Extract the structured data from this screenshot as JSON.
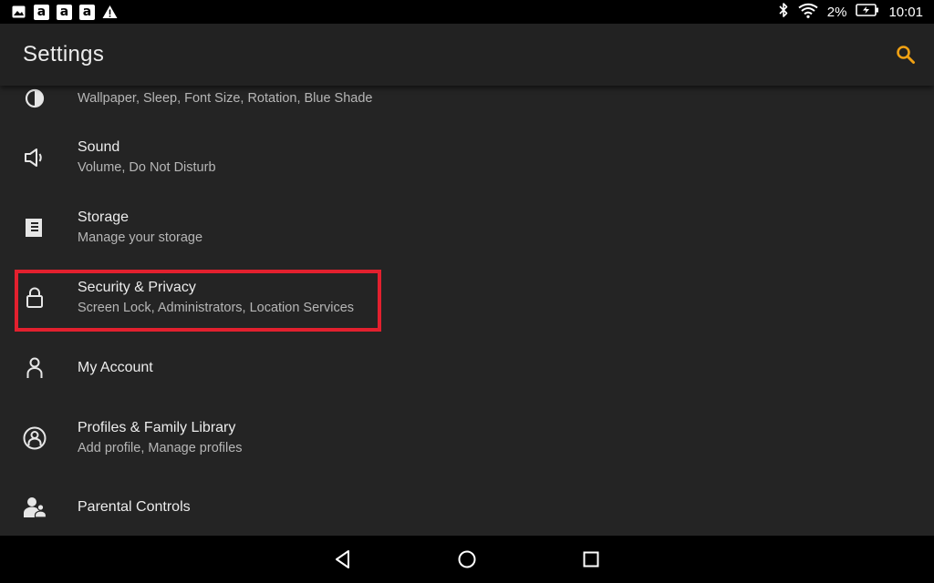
{
  "status_bar": {
    "notification_icons": [
      "image-icon",
      "amazon-icon",
      "amazon-icon",
      "amazon-icon",
      "warning-icon"
    ],
    "amazon_glyph": "a",
    "battery_percent": "2%",
    "time": "10:01"
  },
  "app_bar": {
    "title": "Settings",
    "accent_color": "#f0a113"
  },
  "settings_items": [
    {
      "icon": "display-icon",
      "title": "",
      "subtitle": "Wallpaper, Sleep, Font Size, Rotation, Blue Shade"
    },
    {
      "icon": "speaker-icon",
      "title": "Sound",
      "subtitle": "Volume, Do Not Disturb"
    },
    {
      "icon": "storage-icon",
      "title": "Storage",
      "subtitle": "Manage your storage"
    },
    {
      "icon": "lock-icon",
      "title": "Security & Privacy",
      "subtitle": "Screen Lock, Administrators, Location Services"
    },
    {
      "icon": "person-icon",
      "title": "My Account",
      "subtitle": ""
    },
    {
      "icon": "profile-circle-icon",
      "title": "Profiles & Family Library",
      "subtitle": "Add profile, Manage profiles"
    },
    {
      "icon": "parental-icon",
      "title": "Parental Controls",
      "subtitle": ""
    }
  ],
  "highlight_color": "#e2202e",
  "nav_bar": {
    "buttons": [
      "back-icon",
      "home-icon",
      "recents-icon"
    ]
  }
}
